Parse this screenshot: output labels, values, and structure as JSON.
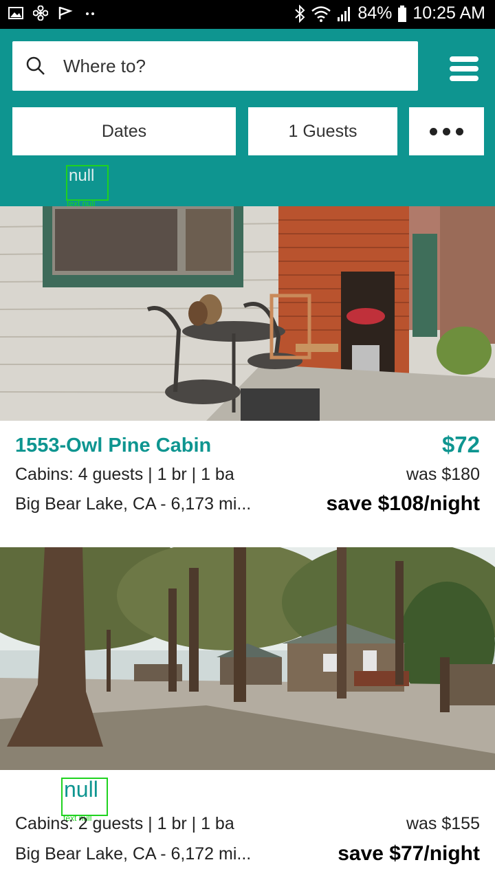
{
  "status_bar": {
    "battery": "84%",
    "time": "10:25 AM",
    "icons": [
      "gallery-icon",
      "fan-icon",
      "flag-icon",
      "dots-icon",
      "bluetooth-icon",
      "wifi-icon",
      "signal-icon",
      "battery-icon"
    ]
  },
  "header": {
    "search_placeholder": "Where to?",
    "dates_label": "Dates",
    "guests_label": "1 Guests",
    "overlay_text": "null",
    "overlay_subtext": "text null",
    "accent_color": "#0e9590"
  },
  "listings": [
    {
      "title": "1553-Owl Pine Cabin",
      "price": "$72",
      "details": "Cabins: 4 guests | 1 br | 1 ba",
      "was_price": "was $180",
      "location": "Big Bear Lake, CA - 6,173 mi...",
      "savings": "save $108/night"
    },
    {
      "title": "null",
      "title_subtext": "text null",
      "details": "Cabins: 2 guests | 1 br | 1 ba",
      "was_price": "was $155",
      "location": "Big Bear Lake, CA - 6,172 mi...",
      "savings": "save $77/night"
    }
  ]
}
